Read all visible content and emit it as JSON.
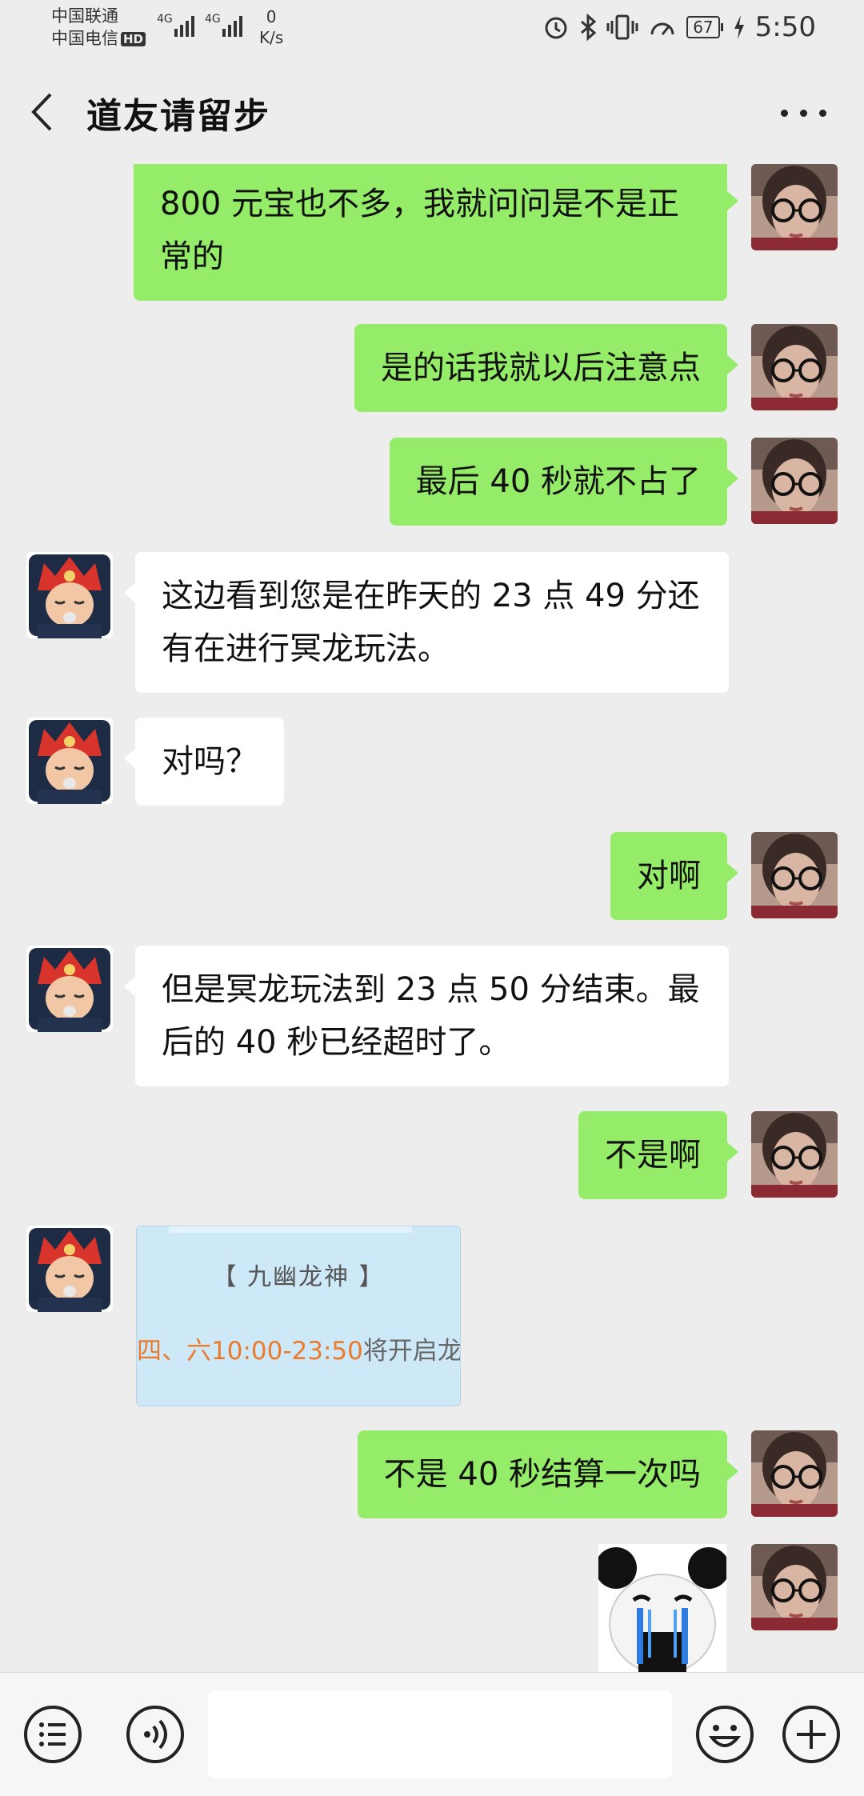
{
  "status_bar": {
    "carrier_1": "中国联通",
    "carrier_2": "中国电信",
    "hd_badge": "HD",
    "network_1": "4G",
    "network_2": "4G",
    "speed_value": "0",
    "speed_unit": "K/s",
    "battery": "67",
    "time": "5:50"
  },
  "header": {
    "title": "道友请留步"
  },
  "messages": [
    {
      "from": "me",
      "text": "800 元宝也不多，我就问问是不是正常的"
    },
    {
      "from": "me",
      "text": "是的话我就以后注意点"
    },
    {
      "from": "me",
      "text": "最后 40 秒就不占了"
    },
    {
      "from": "them",
      "text": "这边看到您是在昨天的 23 点 49 分还有在进行冥龙玩法。"
    },
    {
      "from": "them",
      "text": "对吗？"
    },
    {
      "from": "me",
      "text": "对啊"
    },
    {
      "from": "them",
      "text": "但是冥龙玩法到 23 点 50 分结束。最后的 40 秒已经超时了。"
    },
    {
      "from": "me",
      "text": "不是啊"
    },
    {
      "from": "them",
      "type": "image",
      "image_title": "【 九幽龙神 】",
      "image_time": "四、六10:00-23:50",
      "image_tail": "将开启龙"
    },
    {
      "from": "me",
      "text": "不是 40 秒结算一次吗"
    },
    {
      "from": "me",
      "type": "sticker",
      "sticker": "crying-panda"
    }
  ],
  "input_bar": {
    "left_icon": "list-icon",
    "voice_icon": "voice-icon",
    "input_value": "",
    "emoji_icon": "emoji-icon",
    "add_icon": "plus-icon"
  },
  "colors": {
    "background": "#ededed",
    "my_bubble": "#95ec69",
    "their_bubble": "#ffffff"
  }
}
